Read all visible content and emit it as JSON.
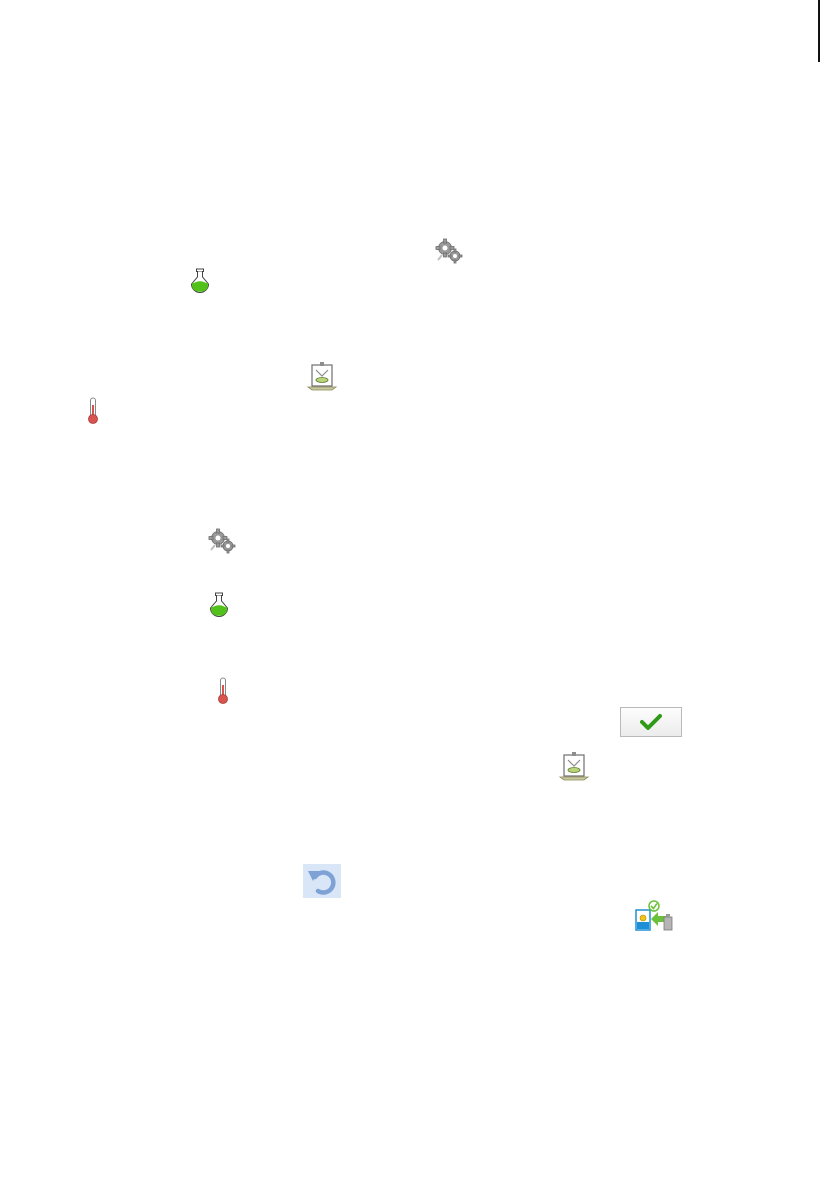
{
  "icons": {
    "settings": "gear-icon",
    "flask": "flask-icon",
    "calibration": "calibration-icon",
    "thermometer": "thermometer-icon",
    "confirm": "checkmark-icon",
    "undo": "undo-icon",
    "export": "export-icon"
  },
  "colors": {
    "gear": "#8d8d8d",
    "flask_liquid": "#52c21a",
    "thermometer": "#d9534f",
    "checkmark": "#2f9a17",
    "undo_bg": "#d8e6f8",
    "undo_arrow": "#7ea2d6",
    "export_blue": "#1e8fd6",
    "export_green": "#6cc13a"
  }
}
